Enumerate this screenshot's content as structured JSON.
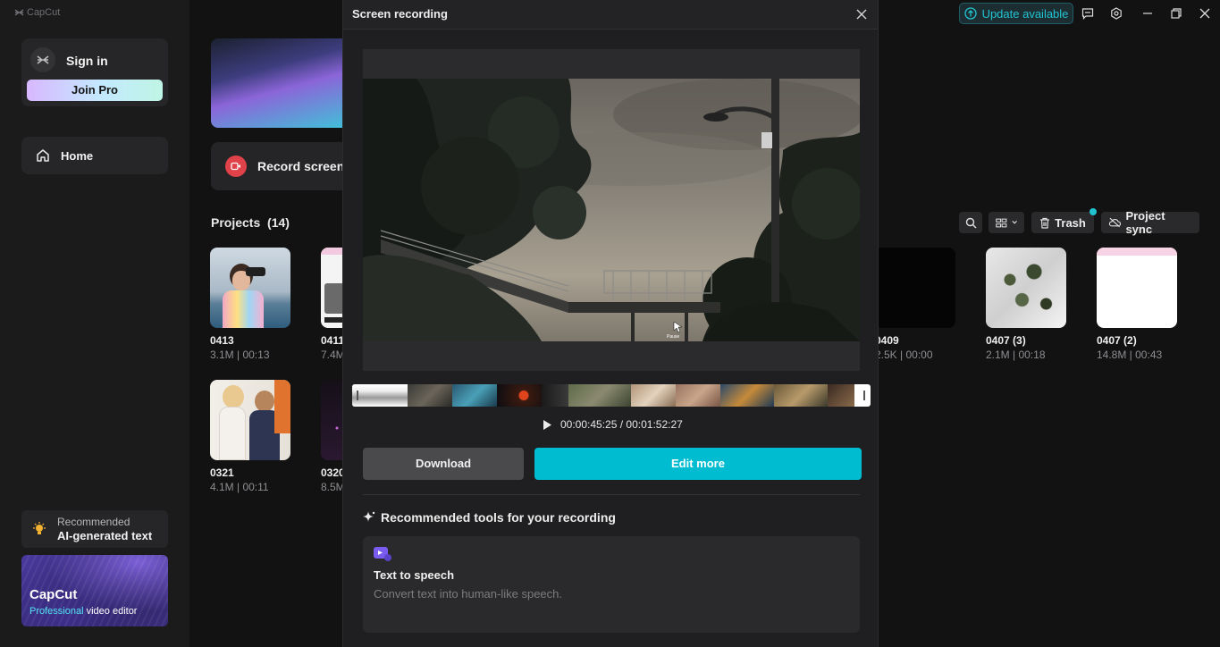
{
  "app": {
    "brand": "CapCut"
  },
  "sidebar": {
    "sign_in": "Sign in",
    "join_pro": "Join Pro",
    "home": "Home",
    "recommended_label": "Recommended",
    "recommended_title": "AI-generated text",
    "promo_title": "CapCut",
    "promo_sub_highlight": "Professional",
    "promo_sub_rest": " video editor"
  },
  "main": {
    "record_screen": "Record screen",
    "projects_title": "Projects",
    "projects_count": "(14)",
    "toolbar": {
      "trash": "Trash",
      "project_sync": "Project sync"
    },
    "projects_row1": [
      {
        "name": "0413",
        "meta": "3.1M | 00:13"
      },
      {
        "name": "0411",
        "meta": "7.4M"
      },
      {
        "name": "0409",
        "meta": "2.5K | 00:00"
      },
      {
        "name": "0407 (3)",
        "meta": "2.1M | 00:18"
      },
      {
        "name": "0407 (2)",
        "meta": "14.8M | 00:43"
      }
    ],
    "projects_row2": [
      {
        "name": "0321",
        "meta": "4.1M | 00:11"
      },
      {
        "name": "0320",
        "meta": "8.5M"
      }
    ]
  },
  "titlebar": {
    "update": "Update available"
  },
  "modal": {
    "title": "Screen recording",
    "time_current": "00:00:45:25",
    "time_sep": " / ",
    "time_total": "00:01:52:27",
    "download": "Download",
    "edit_more": "Edit more",
    "recommended_tools": "Recommended tools for your recording",
    "tool": {
      "title": "Text to speech",
      "desc": "Convert text into human-like speech."
    },
    "video_caption": "Pause"
  },
  "colors": {
    "accent": "#00bcd0",
    "record_red": "#e0424a",
    "update_teal": "#22c3d1"
  }
}
